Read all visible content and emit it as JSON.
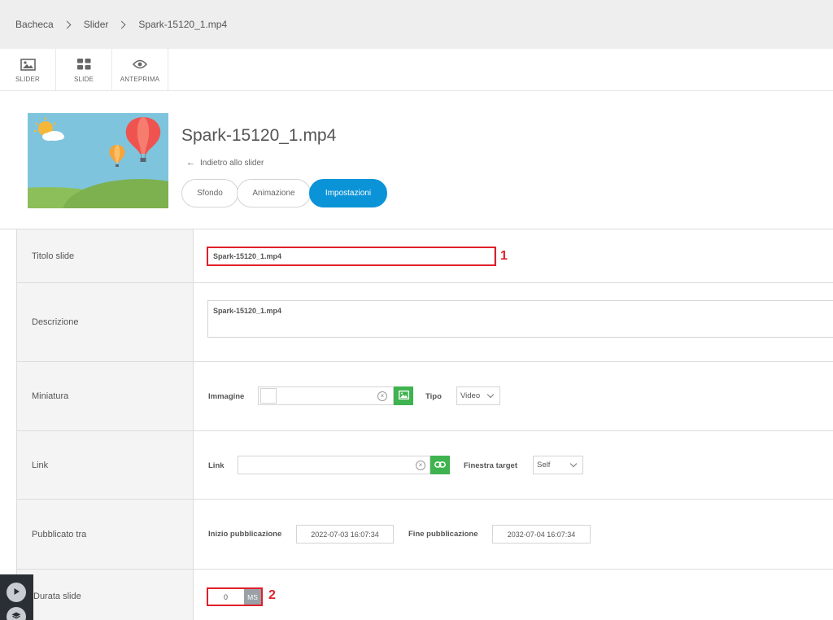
{
  "breadcrumb": [
    "Bacheca",
    "Slider",
    "Spark-15120_1.mp4"
  ],
  "toolbar": [
    {
      "label": "SLIDER",
      "icon": "image-icon"
    },
    {
      "label": "SLIDE",
      "icon": "grid-icon"
    },
    {
      "label": "ANTEPRIMA",
      "icon": "eye-icon"
    }
  ],
  "header": {
    "title": "Spark-15120_1.mp4",
    "back_label": "Indietro allo slider",
    "tabs": [
      "Sfondo",
      "Animazione",
      "Impostazioni"
    ],
    "active_tab": "Impostazioni"
  },
  "form": {
    "title": {
      "label": "Titolo slide",
      "value": "Spark-15120_1.mp4",
      "marker": "1"
    },
    "description": {
      "label": "Descrizione",
      "value": "Spark-15120_1.mp4"
    },
    "thumbnail": {
      "label": "Miniatura",
      "image_label": "Immagine",
      "type_label": "Tipo",
      "type_value": "Video"
    },
    "link": {
      "label": "Link",
      "link_label": "Link",
      "target_label": "Finestra target",
      "target_value": "Self"
    },
    "published": {
      "label": "Pubblicato tra",
      "start_label": "Inizio pubblicazione",
      "start_value": "2022-07-03 16:07:34",
      "end_label": "Fine pubblicazione",
      "end_value": "2032-07-04 16:07:34"
    },
    "duration": {
      "label": "Durata slide",
      "value": "0",
      "unit": "MS",
      "marker": "2"
    }
  },
  "colors": {
    "accent": "#0b93d8",
    "green": "#3fb34f",
    "annotation": "#e0202a"
  }
}
